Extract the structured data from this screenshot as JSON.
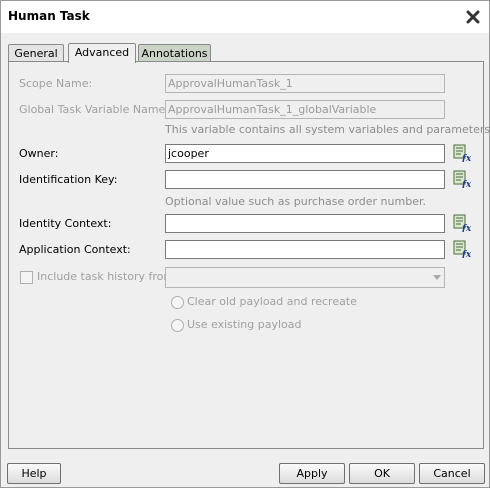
{
  "dialog": {
    "title": "Human Task"
  },
  "tabs": [
    {
      "label": "General"
    },
    {
      "label": "Advanced"
    },
    {
      "label": "Annotations"
    }
  ],
  "form": {
    "scope_name": {
      "label": "Scope Name:",
      "value": "ApprovalHumanTask_1"
    },
    "global_var": {
      "label": "Global Task Variable Name:",
      "value": "ApprovalHumanTask_1_globalVariable",
      "hint": "This variable contains all system variables and parameters."
    },
    "owner": {
      "label": "Owner:",
      "value": "jcooper"
    },
    "identification_key": {
      "label": "Identification Key:",
      "value": "",
      "hint": "Optional value such as purchase order number."
    },
    "identity_context": {
      "label": "Identity Context:",
      "value": ""
    },
    "application_context": {
      "label": "Application Context:",
      "value": ""
    },
    "include_history": {
      "label": "Include task history from:",
      "checked": false,
      "selected": ""
    },
    "radio_clear": {
      "label": "Clear old payload and recreate"
    },
    "radio_existing": {
      "label": "Use existing payload"
    }
  },
  "buttons": {
    "help": "Help",
    "apply": "Apply",
    "ok": "OK",
    "cancel": "Cancel"
  },
  "icons": {
    "close": "close-icon",
    "expression_builder": "expression-builder-icon"
  }
}
